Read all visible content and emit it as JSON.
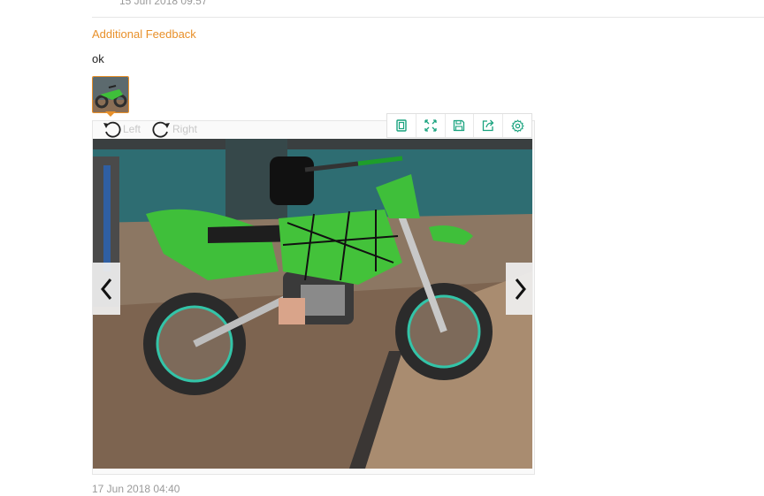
{
  "previous_review": {
    "date": "15 Jun 2018 09:57"
  },
  "feedback": {
    "label": "Additional Feedback",
    "text": "ok"
  },
  "viewer": {
    "rotate_left_label": "Left",
    "rotate_right_label": "Right",
    "toolbar_icons": [
      "fit-page-icon",
      "fullscreen-icon",
      "save-icon",
      "share-icon",
      "settings-icon"
    ],
    "prev_icon": "chevron-left-icon",
    "next_icon": "chevron-right-icon"
  },
  "review_date": "17 Jun 2018 04:40",
  "colors": {
    "accent": "#e8902a",
    "toolbar_icon": "#1aa37f"
  }
}
